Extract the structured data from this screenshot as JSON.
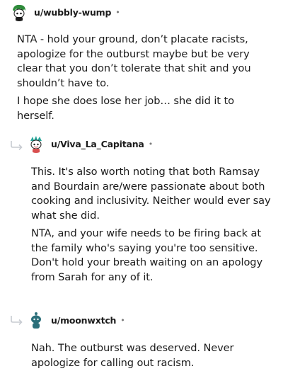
{
  "comments": [
    {
      "username": "u/wubbly-wump",
      "separator": "•",
      "avatar_icon": "snoo-avatar-green-hair-icon",
      "paragraphs": [
        "NTA - hold your ground, don’t placate racists, apologize for the outburst maybe but be very clear that you don’t tolerate that shit and you shouldn’t have to.",
        "I hope she does lose her job… she did it to herself."
      ]
    },
    {
      "username": "u/Viva_La_Capitana",
      "separator": "•",
      "avatar_icon": "snoo-avatar-teal-hair-icon",
      "paragraphs": [
        "This. It's also worth noting that both Ramsay and Bourdain are/were passionate about both cooking and inclusivity. Neither would ever say what she did.",
        "NTA, and your wife needs to be firing back at the family who's saying you're too sensitive. Don't hold your breath waiting on an apology from Sarah for any of it."
      ]
    },
    {
      "username": "u/moonwxtch",
      "separator": "•",
      "avatar_icon": "snoo-avatar-teal-body-icon",
      "paragraphs": [
        "Nah. The outburst was deserved. Never apologize for calling out racism."
      ]
    }
  ],
  "colors": {
    "text": "#1c1c1c",
    "meta": "#7c7c7c",
    "reply_arrow": "#c7cbd1"
  }
}
